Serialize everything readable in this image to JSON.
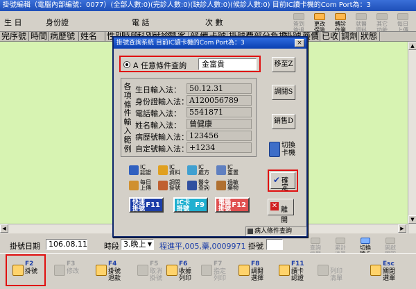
{
  "window": {
    "title": "掛號編輯（電腦內部編號：0077）(全部人數:0)(完診人數:0)(缺診人數:0)(候診人數:0)  目前IC讀卡機的Com Port為：3"
  },
  "top_fields": {
    "birthday": "生 日",
    "id_number": "身份證",
    "phone": "電 話",
    "visits": "次 數"
  },
  "top_buttons": [
    {
      "label": "簽到\n簽退",
      "active": false
    },
    {
      "label": "更改\n保險",
      "active": true
    },
    {
      "label": "轉診\n作業",
      "active": true
    },
    {
      "label": "就醫\n資料",
      "active": false
    },
    {
      "label": "其它\n功能",
      "active": false
    },
    {
      "label": "每日\n上傳",
      "active": false
    }
  ],
  "table": {
    "columns": [
      "完序號",
      "時間",
      "病歷號",
      "姓名",
      "性別",
      "時段",
      "科別",
      "就診",
      "醫",
      "客",
      "部",
      "備",
      "卡號",
      "掛號費",
      "部分負擔",
      "掛號",
      "藥價",
      "已收",
      "調劑",
      "狀態"
    ]
  },
  "status_row": {
    "date_label": "掛號日期",
    "date_value": "106.08.11",
    "period_label": "時段",
    "period_value": "3.晚上",
    "program_status": "程進平,005,藥,0009971",
    "pre_register_label": "掛號",
    "buttons": [
      {
        "label": "查詢\n病歷",
        "active": false
      },
      {
        "label": "累計\n清單",
        "active": false
      },
      {
        "label": "切換\n讀卡",
        "active": true
      },
      {
        "label": "開啟\n關閉",
        "active": false
      }
    ]
  },
  "function_keys": [
    {
      "key": "F2",
      "label": "掛號",
      "active": true
    },
    {
      "key": "F3",
      "label": "修改",
      "active": false
    },
    {
      "key": "F4",
      "label": "掛號\n退款",
      "active": true
    },
    {
      "key": "F5",
      "label": "取消\n掛號",
      "active": false
    },
    {
      "key": "F6",
      "label": "收據\n列印",
      "active": true
    },
    {
      "key": "F7",
      "label": "指定\n列印",
      "active": false
    },
    {
      "key": "F8",
      "label": "調閱\n選擇",
      "active": true
    },
    {
      "key": "F11",
      "label": "讀卡\n認證",
      "active": true
    },
    {
      "key": "",
      "label": "列印\n清單",
      "active": false
    },
    {
      "key": "Esc",
      "label": "關閉\n選單",
      "active": true
    }
  ],
  "dialog": {
    "title": "掛號查詢系統  目前IC讀卡機的Com Port為：3",
    "close_glyph": "×",
    "option_label": "A  任意條件查詢",
    "query_value": "金富貴",
    "vertical_label": "各項條件輸入範例",
    "examples": [
      {
        "label": "生日輸入法：",
        "value": "50.12.31"
      },
      {
        "label": "身份證輸入法：",
        "value": "A120056789"
      },
      {
        "label": "電話輸入法：",
        "value": "5541871"
      },
      {
        "label": "姓名輸入法：",
        "value": "曾健康"
      },
      {
        "label": "病歷號輸入法：",
        "value": "123456"
      },
      {
        "label": "自定號輸入法：",
        "value": "+1234"
      }
    ],
    "right_buttons": {
      "register": "移至Z",
      "view": "調閱S",
      "sell": "銷售D"
    },
    "switch_card": "切換\n卡機",
    "icon_buttons": [
      {
        "label": "IC\n認證",
        "color": "#3060c0"
      },
      {
        "label": "IC\n資料",
        "color": "#e0a020"
      },
      {
        "label": "IC\n處方",
        "color": "#40a0d0"
      },
      {
        "label": "IC\n重置",
        "color": "#6080c0"
      },
      {
        "label": "每日\n上傳",
        "color": "#d09030"
      },
      {
        "label": "調閱\n掛號",
        "color": "#c06030"
      },
      {
        "label": "醫令\n查詢",
        "color": "#3050a0"
      },
      {
        "label": "過敏\n藥物",
        "color": "#b07030"
      }
    ],
    "big_buttons": [
      {
        "label": "快速\n掛號",
        "key": "F11",
        "bg": "#1c3ea8"
      },
      {
        "label": "IC卡\n掛號",
        "key": "F9",
        "bg": "#20b0d0"
      },
      {
        "label": "電腦\n掛號",
        "key": "F12",
        "bg": "#e05050"
      }
    ],
    "confirm_label": "確定",
    "confirm_glyph": "✔",
    "leave_label": "離開",
    "leave_glyph": "✕",
    "footer": "病人條件查詢"
  },
  "colors": {
    "table_bg": "#d7f3b2",
    "highlight": "#e01010",
    "title_blue": "#1e4fb8"
  }
}
